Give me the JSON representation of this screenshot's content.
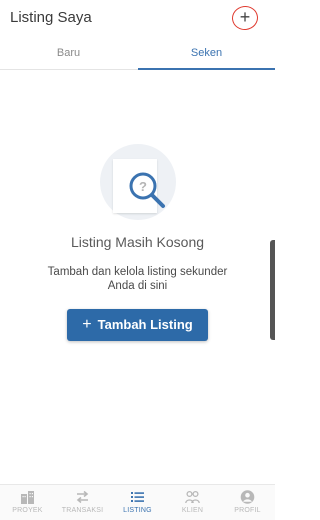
{
  "header": {
    "title": "Listing Saya",
    "add_icon": "plus-icon",
    "add_glyph": "+"
  },
  "tabs": [
    {
      "label": "Baru",
      "active": false
    },
    {
      "label": "Seken",
      "active": true
    }
  ],
  "empty_state": {
    "illustration": "search-document-icon",
    "title": "Listing Masih Kosong",
    "description": "Tambah dan kelola listing sekunder Anda di sini",
    "button_glyph": "+",
    "button_label": "Tambah Listing"
  },
  "bottom_nav": [
    {
      "label": "PROYEK",
      "icon": "building-icon",
      "active": false
    },
    {
      "label": "TRANSAKSI",
      "icon": "swap-arrows-icon",
      "active": false
    },
    {
      "label": "LISTING",
      "icon": "list-icon",
      "active": true
    },
    {
      "label": "KLIEN",
      "icon": "people-icon",
      "active": false
    },
    {
      "label": "PROFIL",
      "icon": "user-icon",
      "active": false
    }
  ],
  "colors": {
    "accent": "#3b73b0",
    "button": "#2d6aa8",
    "annotation": "#e03a2f",
    "inactive": "#b8b8b8"
  }
}
